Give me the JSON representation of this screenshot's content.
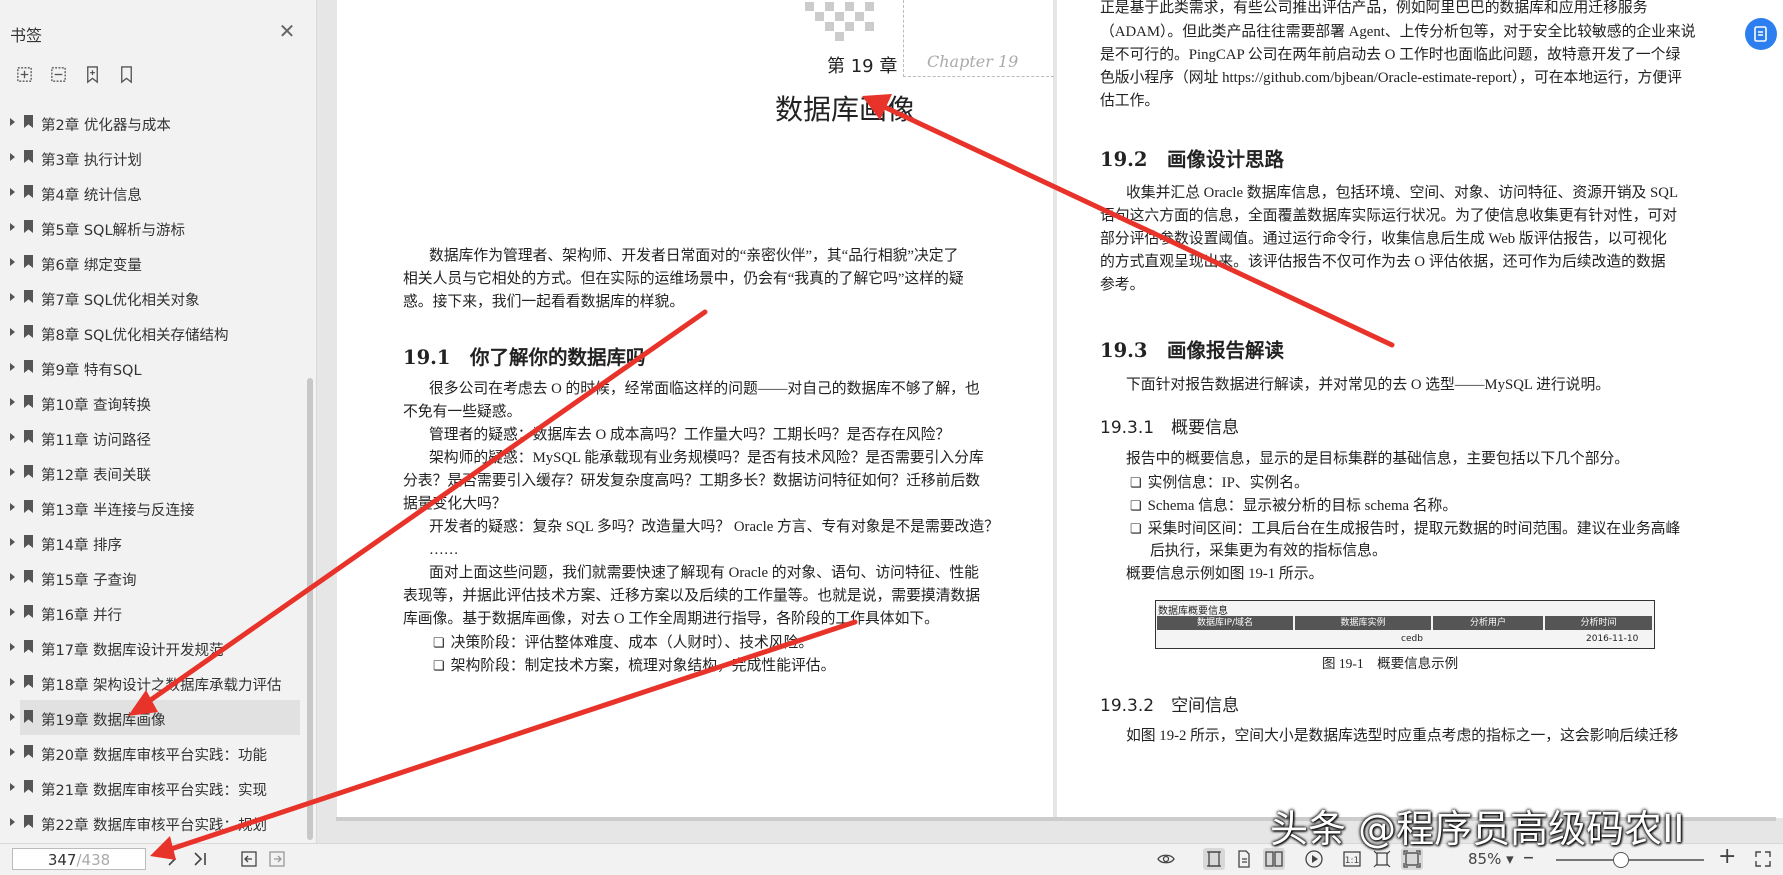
{
  "sidebar": {
    "title": "书签",
    "close_icon": "close-icon",
    "tools": [
      "expand-all-icon",
      "collapse-all-icon",
      "add-bookmark-icon",
      "bookmark-icon"
    ],
    "items": [
      {
        "label": "第2章 优化器与成本"
      },
      {
        "label": "第3章 执行计划"
      },
      {
        "label": "第4章 统计信息"
      },
      {
        "label": "第5章 SQL解析与游标"
      },
      {
        "label": "第6章 绑定变量"
      },
      {
        "label": "第7章 SQL优化相关对象"
      },
      {
        "label": "第8章 SQL优化相关存储结构"
      },
      {
        "label": "第9章 特有SQL"
      },
      {
        "label": "第10章 查询转换"
      },
      {
        "label": "第11章 访问路径"
      },
      {
        "label": "第12章 表间关联"
      },
      {
        "label": "第13章 半连接与反连接"
      },
      {
        "label": "第14章 排序"
      },
      {
        "label": "第15章 子查询"
      },
      {
        "label": "第16章 并行"
      },
      {
        "label": "第17章 数据库设计开发规范"
      },
      {
        "label": "第18章 架构设计之数据库承载力评估"
      },
      {
        "label": "第19章 数据库画像",
        "active": true
      },
      {
        "label": "第20章 数据库审核平台实践：功能"
      },
      {
        "label": "第21章 数据库审核平台实践：实现"
      },
      {
        "label": "第22章 数据库审核平台实践：规划"
      }
    ]
  },
  "left_page": {
    "chapter_num": "第 19 章",
    "chapter_en": "Chapter 19",
    "chapter_title": "数据库画像",
    "intro_1": "数据库作为管理者、架构师、开发者日常面对的“亲密伙伴”，其“品行相貌”决定了",
    "intro_2": "相关人员与它相处的方式。但在实际的运维场景中，仍会有“我真的了解它吗”这样的疑",
    "intro_3": "惑。接下来，我们一起看看数据库的样貌。",
    "s1_title": "19.1　你了解你的数据库吗",
    "s1_p1a": "很多公司在考虑去 O 的时候，经常面临这样的问题——对自己的数据库不够了解，也",
    "s1_p1b": "不免有一些疑惑。",
    "s1_p2": "管理者的疑惑：数据库去 O 成本高吗？工作量大吗？工期长吗？是否存在风险？",
    "s1_p3a": "架构师的疑惑：MySQL 能承载现有业务规模吗？是否有技术风险？是否需要引入分库",
    "s1_p3b": "分表？是否需要引入缓存？研发复杂度高吗？工期多长？数据访问特征如何？迁移前后数",
    "s1_p3c": "据量变化大吗？",
    "s1_p4": "开发者的疑惑：复杂 SQL 多吗？改造量大吗？ Oracle 方言、专有对象是不是需要改造？",
    "s1_p5": "……",
    "s1_p6a": "面对上面这些问题，我们就需要快速了解现有 Oracle 的对象、语句、访问特征、性能",
    "s1_p6b": "表现等，并据此评估技术方案、迁移方案以及后续的工作量等。也就是说，需要摸清数据",
    "s1_p6c": "库画像。基于数据库画像，对去 O 工作全周期进行指导，各阶段的工作具体如下。",
    "s1_b1": "决策阶段：评估整体难度、成本（人财时）、技术风险。",
    "s1_b2": "架构阶段：制定技术方案，梳理对象结构，完成性能评估。"
  },
  "right_page": {
    "top_1": "正是基于此类需求，有些公司推出评估产品，例如阿里巴巴的数据库和应用迁移服务",
    "top_2": "（ADAM）。但此类产品往往需要部署 Agent、上传分析包等，对于安全比较敏感的企业来说",
    "top_3": "是不可行的。PingCAP 公司在两年前启动去 O 工作时也面临此问题，故特意开发了一个绿",
    "top_4": "色版小程序（网址 https://github.com/bjbean/Oracle-estimate-report），可在本地运行，方便评",
    "top_5": "估工作。",
    "s2_title": "19.2　画像设计思路",
    "s2_p1": "收集并汇总 Oracle 数据库信息，包括环境、空间、对象、访问特征、资源开销及 SQL",
    "s2_p2": "语句这六方面的信息，全面覆盖数据库实际运行状况。为了使信息收集更有针对性，可对",
    "s2_p3": "部分评估参数设置阈值。通过运行命令行，收集信息后生成 Web 版评估报告，以可视化",
    "s2_p4": "的方式直观呈现出来。该评估报告不仅可作为去 O 评估依据，还可作为后续改造的数据",
    "s2_p5": "参考。",
    "s3_title": "19.3　画像报告解读",
    "s3_p1": "下面针对报告数据进行解读，并对常见的去 O 选型——MySQL 进行说明。",
    "s31_title": "19.3.1　概要信息",
    "s31_p1": "报告中的概要信息，显示的是目标集群的基础信息，主要包括以下几个部分。",
    "s31_b1": "实例信息：IP、实例名。",
    "s31_b2": "Schema 信息：显示被分析的目标 schema 名称。",
    "s31_b3a": "采集时间区间：工具后台在生成报告时，提取元数据的时间范围。建议在业务高峰",
    "s31_b3b": "后执行，采集更为有效的指标信息。",
    "s31_p2": "概要信息示例如图 19-1 所示。",
    "fig_title": "数据库概要信息",
    "fig_headers": [
      "数据库IP/域名",
      "数据库实例",
      "分析用户",
      "分析时间"
    ],
    "fig_values": [
      "",
      "cedb",
      "",
      "2016-11-10"
    ],
    "fig_caption": "图 19-1　概要信息示例",
    "s32_title": "19.3.2　空间信息",
    "s32_p1": "如图 19-2 所示，空间大小是数据库选型时应重点考虑的指标之一，这会影响后续迁移"
  },
  "bottombar": {
    "current_page": "347",
    "total_pages": "/438",
    "zoom": "85%",
    "zoom_level": 0.43
  },
  "watermark": "头条 @程序员高级码农II"
}
